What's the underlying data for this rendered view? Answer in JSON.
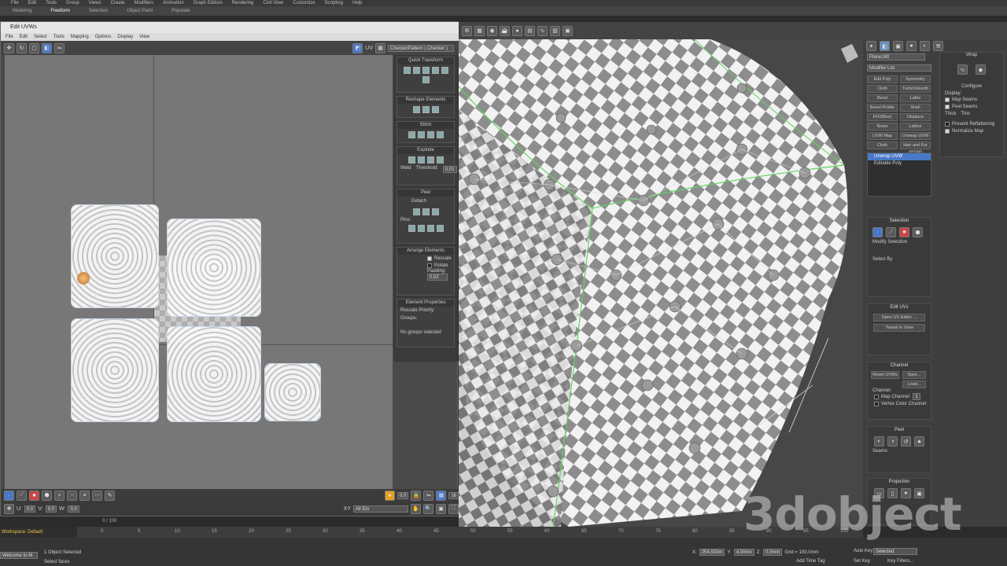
{
  "menu": [
    "File",
    "Edit",
    "Tools",
    "Group",
    "Views",
    "Create",
    "Modifiers",
    "Animation",
    "Graph Editors",
    "Rendering",
    "Civil View",
    "Customize",
    "Scripting",
    "Help"
  ],
  "ribbon": {
    "tabs": [
      "Modeling",
      "Freeform",
      "Selection",
      "Object Paint",
      "Populate"
    ],
    "active": 1
  },
  "uvw": {
    "title": "Edit UVWs",
    "menu": [
      "File",
      "Edit",
      "Select",
      "Tools",
      "Mapping",
      "Options",
      "Display",
      "View"
    ],
    "uv_label": "UV",
    "checker": "CheckerPattern ( Checker )",
    "panels": {
      "quick": "Quick Transform",
      "reshape": "Reshape Elements",
      "stitch": "Stitch",
      "explode": "Explode",
      "weld": "Weld",
      "threshold": "Threshold:",
      "threshold_val": "0,01",
      "peel": "Peel",
      "detach": "Detach",
      "pins": "Pins:",
      "arrange": "Arrange Elements",
      "rescale": "Rescale",
      "rotate": "Rotate",
      "padding": "Padding:",
      "padding_val": "0,02",
      "elprops": "Element Properties",
      "rescale_priority": "Rescale Priority:",
      "groups": "Groups:",
      "no_groups": "No groups selected"
    },
    "bottom": {
      "u": "U:",
      "u_val": "0,0",
      "v": "V:",
      "v_val": "0,0",
      "w": "W:",
      "w_val": "0,0",
      "zoom": "0,0",
      "xy": "XY",
      "all_ids": "All IDs",
      "val16": "16"
    }
  },
  "right": {
    "name": "Plane180",
    "modlist": "Modifier List",
    "buttons": [
      "Edit Poly",
      "Symmetry",
      "Cloth",
      "TurboSmooth",
      "Bend",
      "Lathe",
      "Bevel Profile",
      "Shell",
      "FFD(Box)",
      "Displace",
      "Noise",
      "Lattice",
      "UVW Map",
      "Unwrap UVW",
      "Cloth",
      "Hair and Fur (WSM)"
    ],
    "stack": [
      "Unwrap UVW",
      "Editable Poly"
    ],
    "sel": "Selection",
    "modsel": "Modify Selection",
    "selby": "Select By",
    "edituvs": "Edit UVs",
    "open_ed": "Open UV Editor ...",
    "tweak": "Tweak In View",
    "channel": "Channel",
    "reset": "Reset UVWs",
    "save": "Save...",
    "load": "Load...",
    "channel_lbl": "Channel:",
    "map_ch": "Map Channel:",
    "map_val": "1",
    "vcolor": "Vertex Color Channel",
    "peel": "Peel",
    "seams": "Seams:",
    "projection": "Projection",
    "wrap": "Wrap",
    "configure": "Configure",
    "display": "Display:",
    "map_seams": "Map Seams",
    "peel_seams": "Peel Seams",
    "thick": "Thick",
    "thin": "Thin",
    "prevent": "Prevent Reflattening",
    "normalize": "Normalize Map"
  },
  "timeline": {
    "frame": "0 / 100",
    "ticks": [
      "0",
      "5",
      "10",
      "15",
      "20",
      "25",
      "30",
      "35",
      "40",
      "45",
      "50",
      "55",
      "60",
      "65",
      "70",
      "75",
      "80",
      "85",
      "90",
      "95",
      "100"
    ]
  },
  "status": {
    "workspace": "Workspace: Default",
    "welcome": "Welcome to M",
    "objects": "1 Object Selected",
    "select_faces": "Select faces",
    "x": "X:",
    "x_val": "254,933m",
    "y": "Y:",
    "y_val": "4,004m",
    "z": "Z:",
    "z_val": "0,0mm",
    "grid": "Grid = 100,0mm",
    "add_time": "Add Time Tag",
    "autokey": "Auto Key",
    "setkey": "Set Key",
    "selected": "Selected",
    "filters": "Key Filters..."
  },
  "watermark": "3dobject"
}
